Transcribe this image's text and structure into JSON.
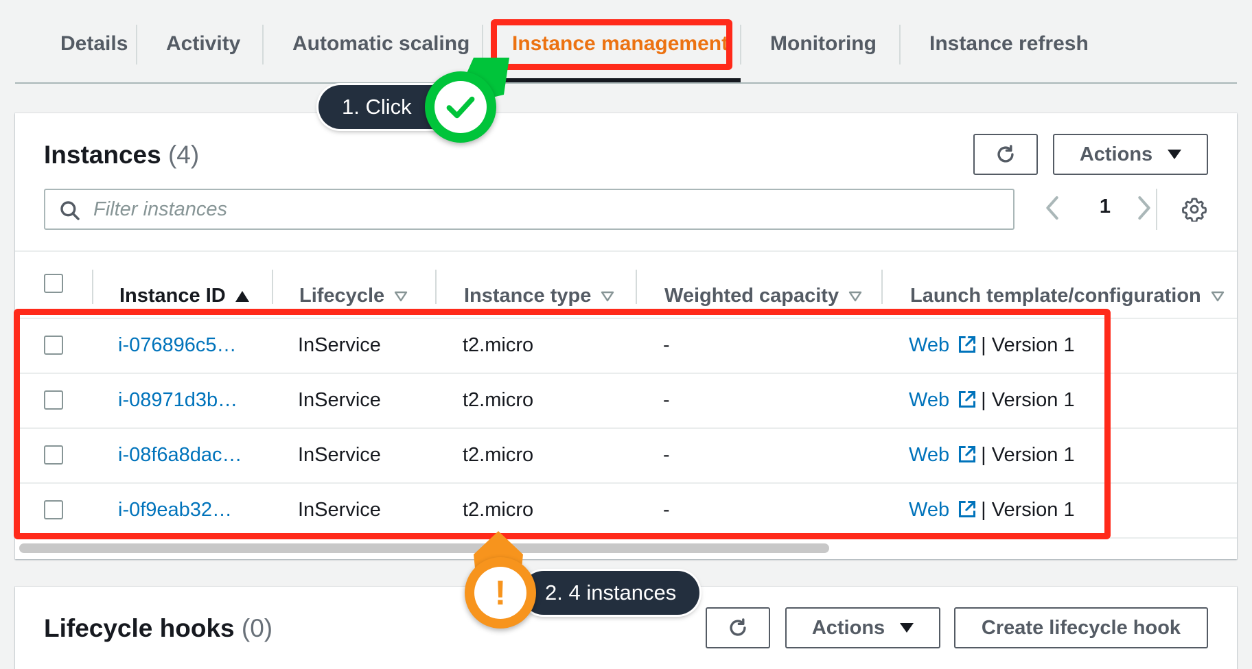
{
  "tabs": [
    {
      "label": "Details"
    },
    {
      "label": "Activity"
    },
    {
      "label": "Automatic scaling"
    },
    {
      "label": "Instance management"
    },
    {
      "label": "Monitoring"
    },
    {
      "label": "Instance refresh"
    }
  ],
  "active_tab": "Instance management",
  "instances_panel": {
    "title": "Instances",
    "count": "(4)",
    "actions_label": "Actions",
    "search_placeholder": "Filter instances",
    "page": "1",
    "columns": [
      {
        "label": "Instance ID",
        "sort": "ascending"
      },
      {
        "label": "Lifecycle"
      },
      {
        "label": "Instance type"
      },
      {
        "label": "Weighted capacity"
      },
      {
        "label": "Launch template/configuration"
      }
    ],
    "rows": [
      {
        "id": "i-076896c5…",
        "lifecycle": "InService",
        "type": "t2.micro",
        "weight": "-",
        "template": "Web",
        "version": "| Version 1"
      },
      {
        "id": "i-08971d3b…",
        "lifecycle": "InService",
        "type": "t2.micro",
        "weight": "-",
        "template": "Web",
        "version": "| Version 1"
      },
      {
        "id": "i-08f6a8dac…",
        "lifecycle": "InService",
        "type": "t2.micro",
        "weight": "-",
        "template": "Web",
        "version": "| Version 1"
      },
      {
        "id": "i-0f9eab32…",
        "lifecycle": "InService",
        "type": "t2.micro",
        "weight": "-",
        "template": "Web",
        "version": "| Version 1"
      }
    ]
  },
  "hooks_panel": {
    "title": "Lifecycle hooks",
    "count": "(0)",
    "actions_label": "Actions",
    "create_label": "Create lifecycle hook"
  },
  "annotations": {
    "step1": "1. Click",
    "step2": "2. 4 instances",
    "box_color": "#ff2a1a",
    "step1_color": "#00c43a",
    "step2_color": "#f7941d"
  },
  "colors": {
    "accent": "#ec7211",
    "link": "#0073bb",
    "background": "#f2f3f3"
  }
}
